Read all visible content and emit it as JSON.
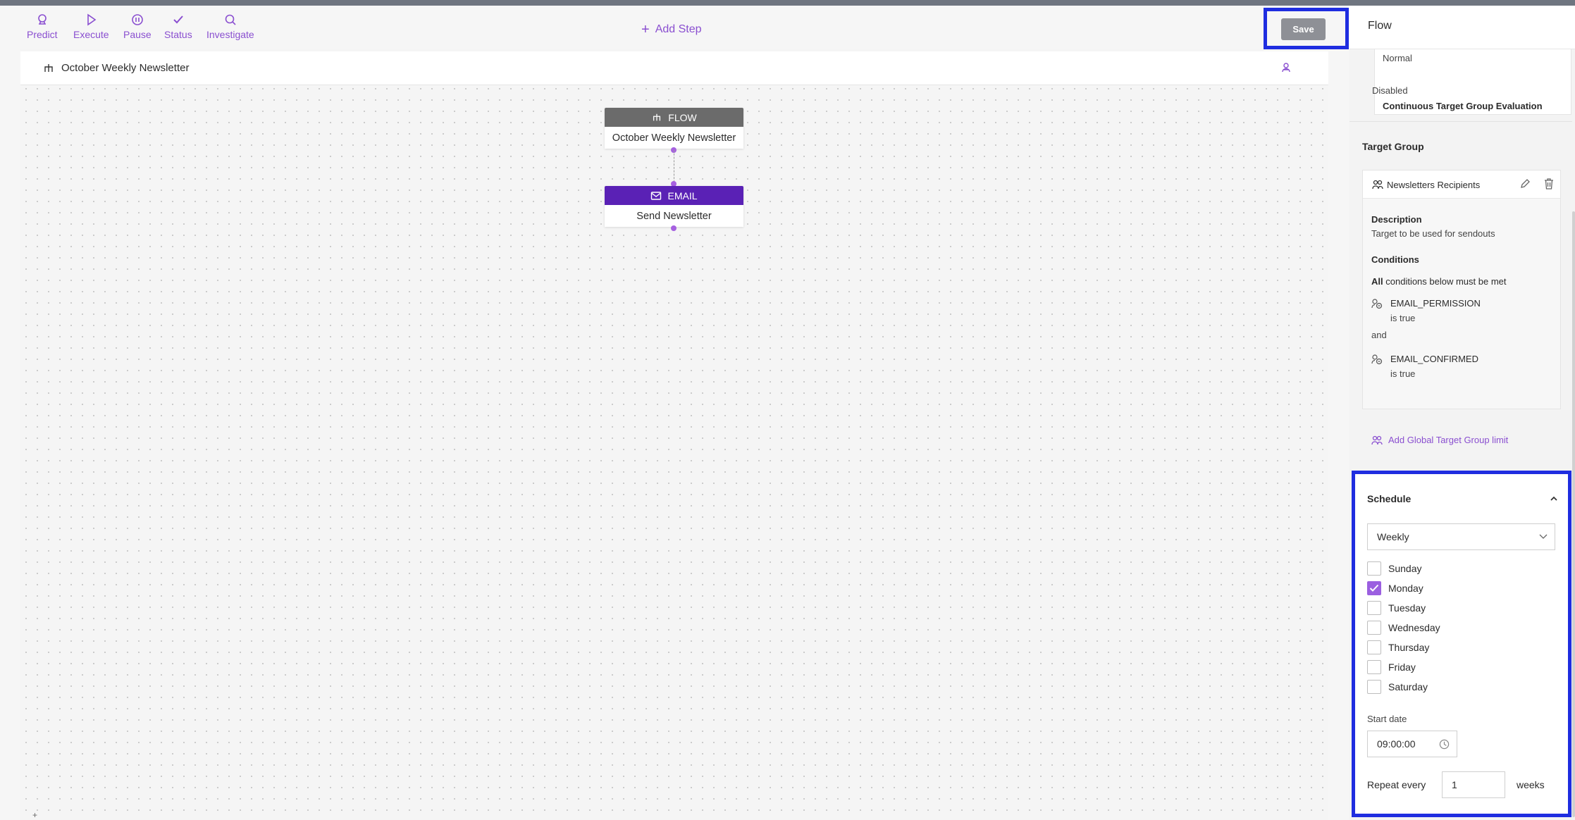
{
  "toolbar": {
    "predict": "Predict",
    "execute": "Execute",
    "pause": "Pause",
    "status": "Status",
    "investigate": "Investigate",
    "add_step": "Add Step",
    "save": "Save"
  },
  "flow_bar": {
    "name": "October Weekly Newsletter"
  },
  "nodes": {
    "flow": {
      "type": "FLOW",
      "name": "October Weekly Newsletter",
      "color": "#6b6b6b"
    },
    "email": {
      "type": "EMAIL",
      "name": "Send Newsletter",
      "color": "#5a21b5"
    }
  },
  "panel": {
    "title": "Flow",
    "top_card": {
      "cut_value": "Normal",
      "cte_label": "Continuous Target Group Evaluation",
      "cte_value": "Disabled"
    },
    "target_group": {
      "heading": "Target Group",
      "name": "Newsletters Recipients",
      "description_label": "Description",
      "description": "Target to be used for sendouts",
      "conditions_label": "Conditions",
      "all_word": "All",
      "all_rest": "conditions below must be met",
      "conditions": [
        {
          "field": "EMAIL_PERMISSION",
          "op": "is true"
        },
        {
          "field": "EMAIL_CONFIRMED",
          "op": "is true"
        }
      ],
      "joiner": "and",
      "add_limit": "Add Global Target Group limit"
    },
    "schedule": {
      "heading": "Schedule",
      "frequency": "Weekly",
      "days": [
        {
          "label": "Sunday",
          "checked": false
        },
        {
          "label": "Monday",
          "checked": true
        },
        {
          "label": "Tuesday",
          "checked": false
        },
        {
          "label": "Wednesday",
          "checked": false
        },
        {
          "label": "Thursday",
          "checked": false
        },
        {
          "label": "Friday",
          "checked": false
        },
        {
          "label": "Saturday",
          "checked": false
        }
      ],
      "start_date_label": "Start date",
      "start_time": "09:00:00",
      "repeat_label": "Repeat every",
      "repeat_value": "1",
      "repeat_unit": "weeks"
    }
  },
  "colors": {
    "accent": "#8a4fd0",
    "highlight": "#1f2de0"
  }
}
